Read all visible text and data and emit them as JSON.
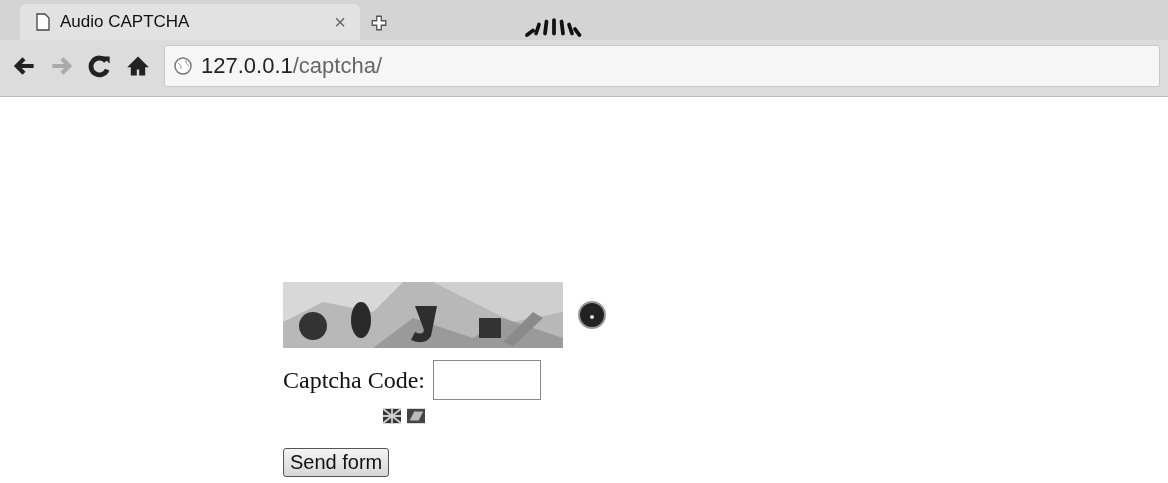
{
  "browser": {
    "tab": {
      "title": "Audio CAPTCHA",
      "close": "×"
    },
    "address": {
      "host": "127.0.0.1",
      "path": "/captcha/"
    }
  },
  "form": {
    "label": "Captcha Code:",
    "button": "Send form"
  }
}
